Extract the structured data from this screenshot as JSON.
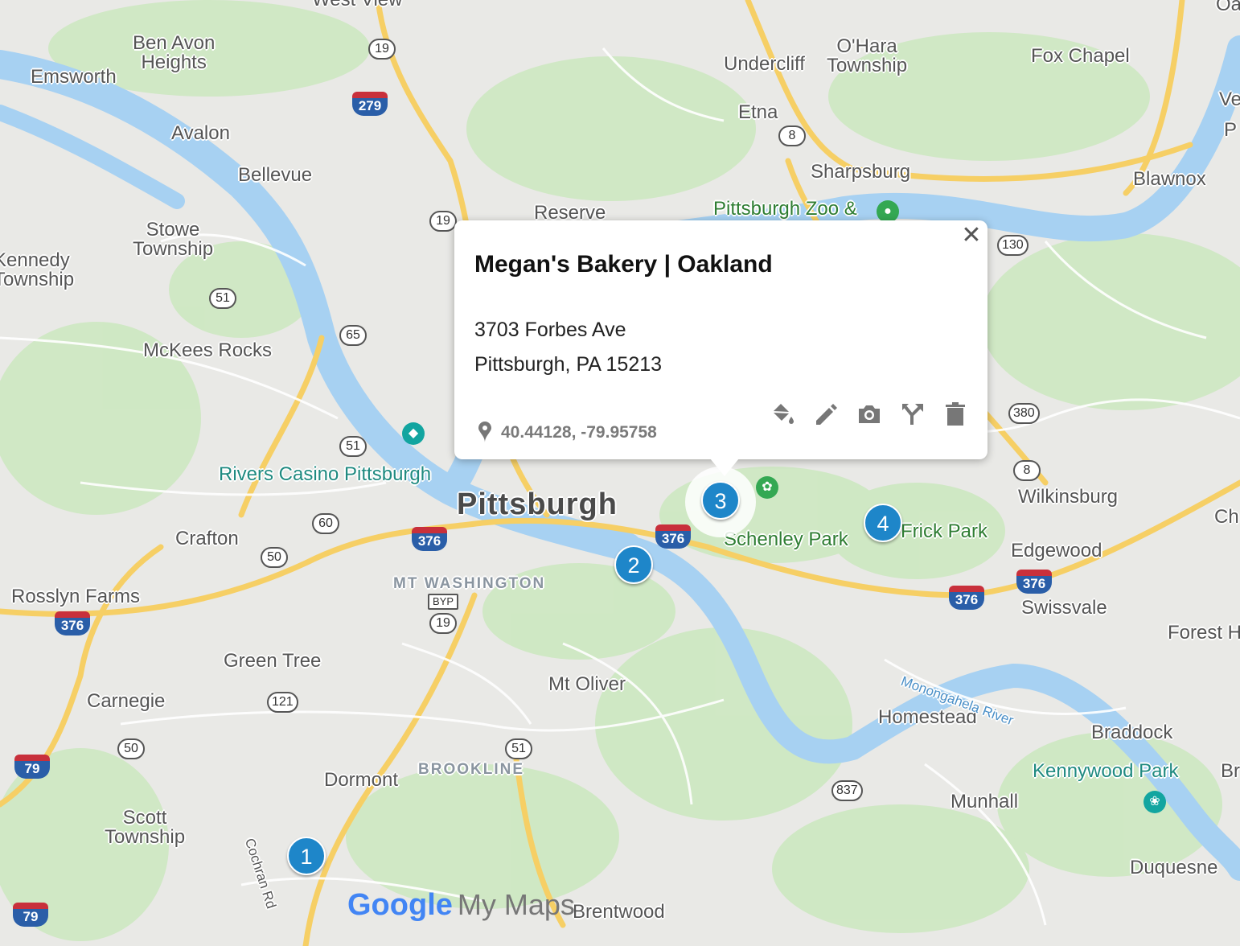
{
  "map": {
    "places": [
      {
        "id": "west-view",
        "text": "West View"
      },
      {
        "id": "ben-avon",
        "text": "Ben Avon\nHeights"
      },
      {
        "id": "emsworth",
        "text": "Emsworth"
      },
      {
        "id": "avalon",
        "text": "Avalon"
      },
      {
        "id": "bellevue",
        "text": "Bellevue"
      },
      {
        "id": "stowe",
        "text": "Stowe\nTownship"
      },
      {
        "id": "kennedy",
        "text": "Kennedy\nTownship"
      },
      {
        "id": "mckees-rocks",
        "text": "McKees Rocks"
      },
      {
        "id": "crafton",
        "text": "Crafton"
      },
      {
        "id": "rosslyn",
        "text": "Rosslyn Farms"
      },
      {
        "id": "green-tree",
        "text": "Green Tree"
      },
      {
        "id": "carnegie",
        "text": "Carnegie"
      },
      {
        "id": "dormont",
        "text": "Dormont"
      },
      {
        "id": "scott",
        "text": "Scott\nTownship"
      },
      {
        "id": "brentwood",
        "text": "Brentwood"
      },
      {
        "id": "mt-oliver",
        "text": "Mt Oliver"
      },
      {
        "id": "homestead",
        "text": "Homestead"
      },
      {
        "id": "munhall",
        "text": "Munhall"
      },
      {
        "id": "braddock",
        "text": "Braddock"
      },
      {
        "id": "duquesne",
        "text": "Duquesne"
      },
      {
        "id": "swissvale",
        "text": "Swissvale"
      },
      {
        "id": "edgewood",
        "text": "Edgewood"
      },
      {
        "id": "wilkinsburg",
        "text": "Wilkinsburg"
      },
      {
        "id": "forest-hills",
        "text": "Forest H"
      },
      {
        "id": "blawnox",
        "text": "Blawnox"
      },
      {
        "id": "fox-chapel",
        "text": "Fox Chapel"
      },
      {
        "id": "ohara",
        "text": "O'Hara\nTownship"
      },
      {
        "id": "undercliff",
        "text": "Undercliff"
      },
      {
        "id": "etna",
        "text": "Etna"
      },
      {
        "id": "sharpsburg",
        "text": "Sharpsburg"
      },
      {
        "id": "reserve",
        "text": "Reserve"
      },
      {
        "id": "ch",
        "text": "Ch"
      },
      {
        "id": "br",
        "text": "Br"
      },
      {
        "id": "oa",
        "text": "Oa"
      },
      {
        "id": "ve",
        "text": "Ve"
      },
      {
        "id": "p",
        "text": "P"
      }
    ],
    "city": "Pittsburgh",
    "districts": [
      "MT WASHINGTON",
      "BROOKLINE"
    ],
    "river": "Monongahela River",
    "pois": {
      "rivers_casino": "Rivers Casino Pittsburgh",
      "zoo": "Pittsburgh Zoo &",
      "schenley": "Schenley Park",
      "frick": "Frick Park",
      "kennywood": "Kennywood Park"
    },
    "road": "Cochran Rd",
    "shields": [
      "19",
      "19",
      "19",
      "51",
      "51",
      "51",
      "65",
      "60",
      "50",
      "50",
      "121",
      "8",
      "8",
      "130",
      "380",
      "837",
      "BYP"
    ],
    "interstates": [
      "279",
      "376",
      "376",
      "376",
      "376",
      "376",
      "79",
      "79"
    ]
  },
  "markers": [
    "1",
    "2",
    "3",
    "4"
  ],
  "popup": {
    "title": "Megan's Bakery | Oakland",
    "address_line1": "3703 Forbes Ave",
    "address_line2": "Pittsburgh, PA 15213",
    "coordinates": "40.44128, -79.95758",
    "close_icon": "close-icon",
    "actions": [
      "paint-bucket-icon",
      "edit-pencil-icon",
      "camera-icon",
      "directions-icon",
      "delete-trash-icon"
    ]
  },
  "logo": {
    "google": "Google",
    "product": "My Maps"
  },
  "colors": {
    "water": "#a7d1f2",
    "park": "#cde8c1",
    "highway": "#f6cf65",
    "marker": "#1e86c9"
  }
}
